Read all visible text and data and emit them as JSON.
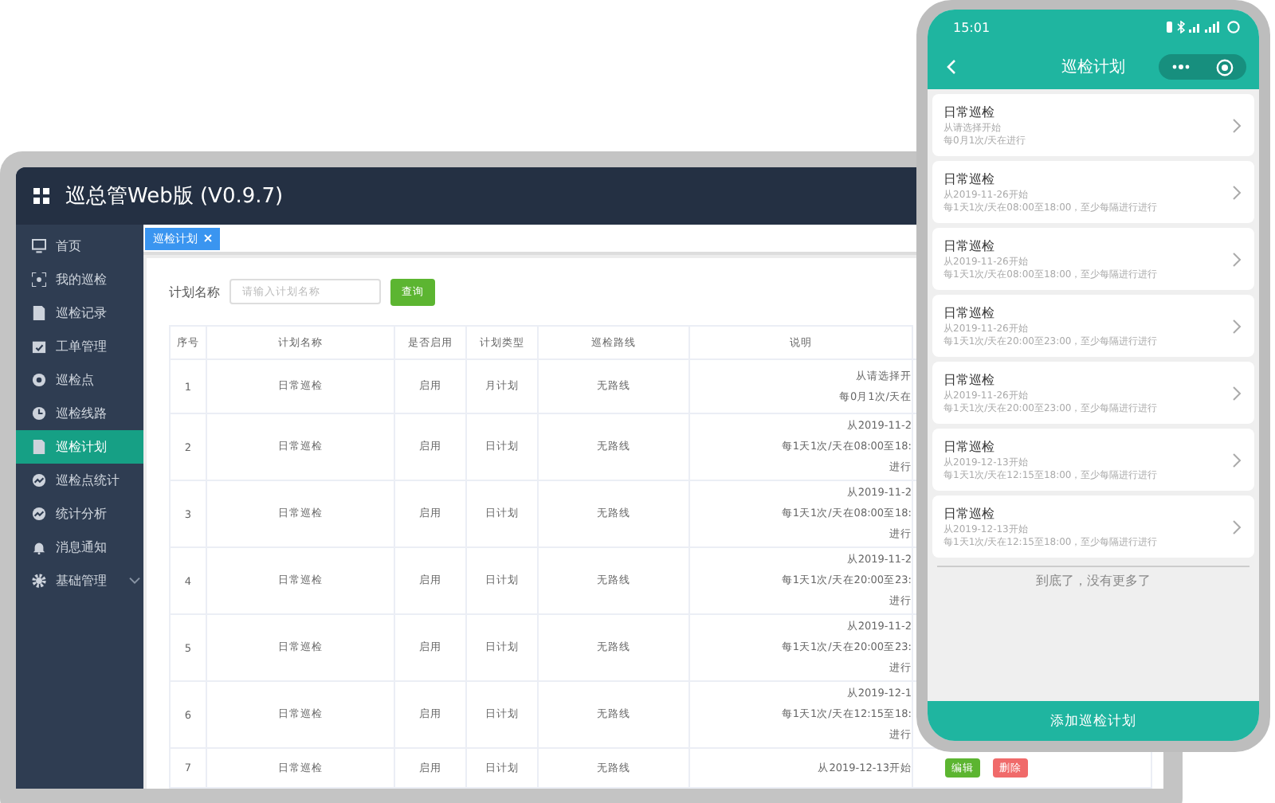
{
  "app": {
    "title": "巡总管Web版 (V0.9.7)"
  },
  "sidebar": {
    "items": [
      {
        "label": "首页",
        "selected": false,
        "submenu": false
      },
      {
        "label": "我的巡检",
        "selected": false,
        "submenu": false
      },
      {
        "label": "巡检记录",
        "selected": false,
        "submenu": false
      },
      {
        "label": "工单管理",
        "selected": false,
        "submenu": false
      },
      {
        "label": "巡检点",
        "selected": false,
        "submenu": false
      },
      {
        "label": "巡检线路",
        "selected": false,
        "submenu": false
      },
      {
        "label": "巡检计划",
        "selected": true,
        "submenu": false
      },
      {
        "label": "巡检点统计",
        "selected": false,
        "submenu": false
      },
      {
        "label": "统计分析",
        "selected": false,
        "submenu": false
      },
      {
        "label": "消息通知",
        "selected": false,
        "submenu": false
      },
      {
        "label": "基础管理",
        "selected": false,
        "submenu": true
      }
    ]
  },
  "tabs": [
    {
      "label": "巡检计划",
      "selected": true
    }
  ],
  "search": {
    "label": "计划名称",
    "placeholder": "请输入计划名称",
    "button": "查询"
  },
  "table": {
    "columns": [
      "序号",
      "计划名称",
      "是否启用",
      "计划类型",
      "巡检路线",
      "说明"
    ],
    "rows": [
      {
        "cells": [
          "1",
          "日常巡检",
          "启用",
          "月计划",
          "无路线"
        ],
        "note": [
          "从请选择开",
          "每0月1次/天在"
        ],
        "actions": []
      },
      {
        "cells": [
          "2",
          "日常巡检",
          "启用",
          "日计划",
          "无路线"
        ],
        "note": [
          "从2019-11-2",
          "每1天1次/天在08:00至18:",
          "进行"
        ],
        "actions": []
      },
      {
        "cells": [
          "3",
          "日常巡检",
          "启用",
          "日计划",
          "无路线"
        ],
        "note": [
          "从2019-11-2",
          "每1天1次/天在08:00至18:",
          "进行"
        ],
        "actions": []
      },
      {
        "cells": [
          "4",
          "日常巡检",
          "启用",
          "日计划",
          "无路线"
        ],
        "note": [
          "从2019-11-2",
          "每1天1次/天在20:00至23:",
          "进行"
        ],
        "actions": []
      },
      {
        "cells": [
          "5",
          "日常巡检",
          "启用",
          "日计划",
          "无路线"
        ],
        "note": [
          "从2019-11-2",
          "每1天1次/天在20:00至23:",
          "进行"
        ],
        "actions": []
      },
      {
        "cells": [
          "6",
          "日常巡检",
          "启用",
          "日计划",
          "无路线"
        ],
        "note": [
          "从2019-12-1",
          "每1天1次/天在12:15至18:",
          "进行"
        ],
        "actions": []
      },
      {
        "cells": [
          "7",
          "日常巡检",
          "启用",
          "日计划",
          "无路线"
        ],
        "note": [
          "从2019-12-13开始"
        ],
        "actions": [
          {
            "label": "编辑",
            "kind": "edit"
          },
          {
            "label": "删除",
            "kind": "delete"
          }
        ]
      }
    ]
  },
  "phone": {
    "time": "15:01",
    "title": "巡检计划",
    "plans": [
      {
        "title": "日常巡检",
        "start": "从请选择开始",
        "rule": "每0月1次/天在进行"
      },
      {
        "title": "日常巡检",
        "start": "从2019-11-26开始",
        "rule": "每1天1次/天在08:00至18:00，至少每隔进行进行"
      },
      {
        "title": "日常巡检",
        "start": "从2019-11-26开始",
        "rule": "每1天1次/天在08:00至18:00，至少每隔进行进行"
      },
      {
        "title": "日常巡检",
        "start": "从2019-11-26开始",
        "rule": "每1天1次/天在20:00至23:00，至少每隔进行进行"
      },
      {
        "title": "日常巡检",
        "start": "从2019-11-26开始",
        "rule": "每1天1次/天在20:00至23:00，至少每隔进行进行"
      },
      {
        "title": "日常巡检",
        "start": "从2019-12-13开始",
        "rule": "每1天1次/天在12:15至18:00，至少每隔进行进行"
      },
      {
        "title": "日常巡检",
        "start": "从2019-12-13开始",
        "rule": "每1天1次/天在12:15至18:00，至少每隔进行进行"
      }
    ],
    "end_text": "到底了，没有更多了",
    "add_button": "添加巡检计划"
  }
}
